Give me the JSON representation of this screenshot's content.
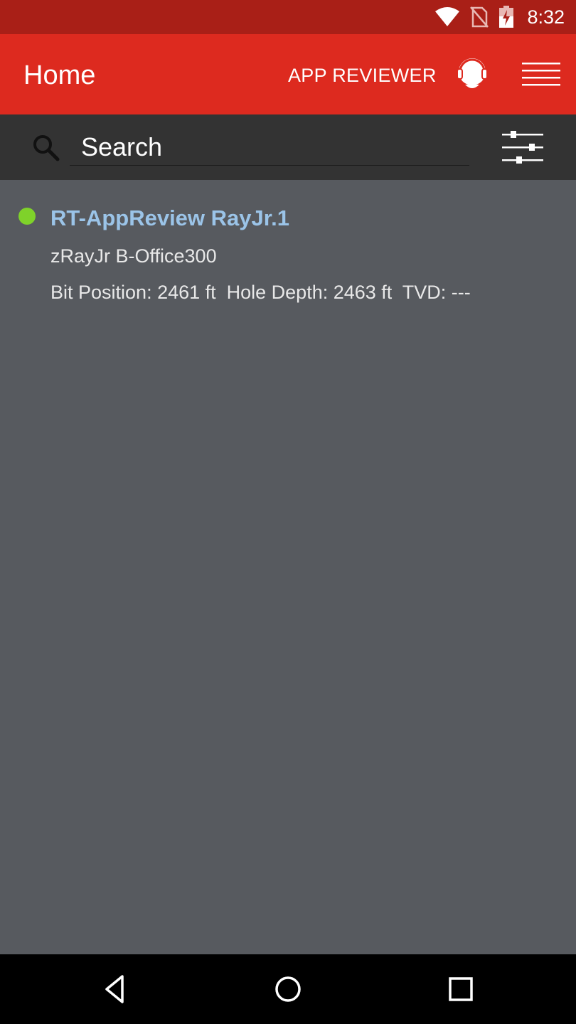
{
  "status_bar": {
    "time": "8:32",
    "icons": [
      "wifi-icon",
      "no-sim-icon",
      "battery-charging-icon"
    ]
  },
  "app_bar": {
    "title": "Home",
    "reviewer_label": "APP REVIEWER",
    "icons": [
      "support-headset-icon",
      "menu-icon"
    ],
    "color": "#dd2a1f"
  },
  "search": {
    "placeholder": "Search",
    "value": "",
    "icons": [
      "search-icon",
      "filter-sliders-icon"
    ]
  },
  "wells": [
    {
      "name": "RT-AppReview RayJr.1",
      "subtitle": "zRayJr B-Office300",
      "metrics": "Bit Position: 2461 ft  Hole Depth: 2463 ft  TVD: ---",
      "status_color": "#7fd22a"
    }
  ],
  "nav_bar": {
    "buttons": [
      "back-icon",
      "home-icon",
      "recents-icon"
    ]
  }
}
